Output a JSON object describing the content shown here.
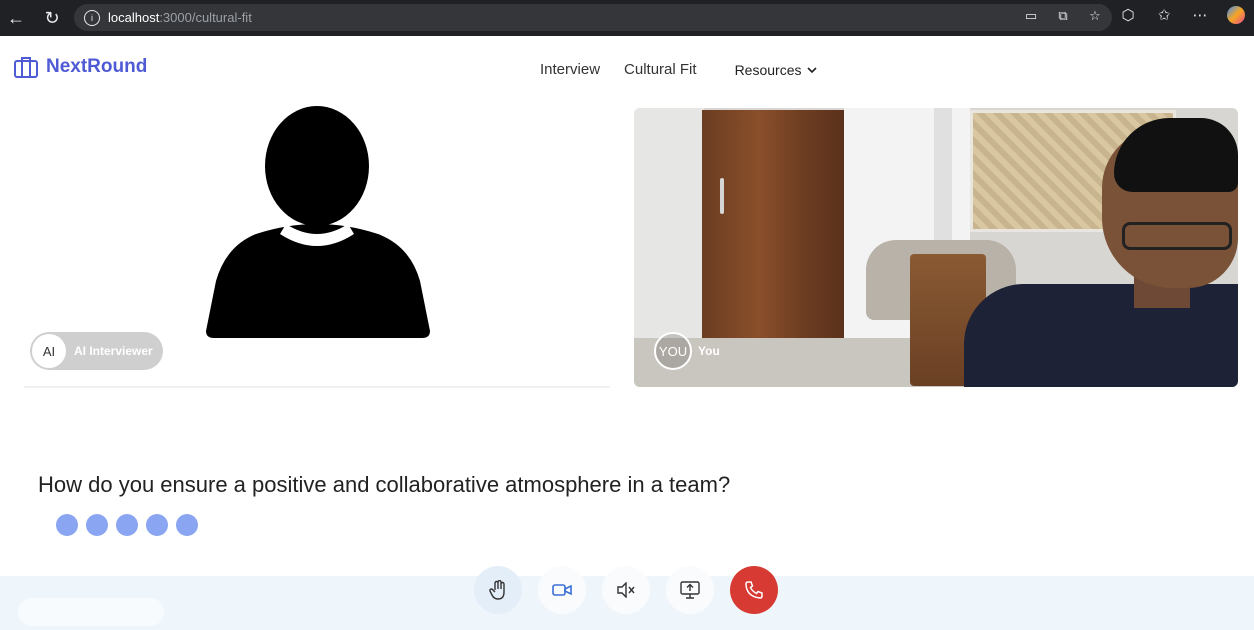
{
  "browser": {
    "url_host": "localhost",
    "url_path": ":3000/cultural-fit",
    "icons": [
      "back-icon",
      "reload-icon",
      "info-icon",
      "cast-icon",
      "screenshot-icon",
      "star-icon",
      "extensions-icon",
      "favorites-icon",
      "more-icon",
      "copilot-icon"
    ]
  },
  "header": {
    "brand": "NextRound",
    "nav": {
      "interview": "Interview",
      "cultural_fit": "Cultural Fit",
      "resources": "Resources"
    }
  },
  "ai_tile": {
    "avatar_initials": "AI",
    "label": "AI Interviewer"
  },
  "user_tile": {
    "avatar_initials": "YOU",
    "label": "You"
  },
  "question": {
    "text": "How do you ensure a positive and collaborative atmosphere in a team?"
  },
  "controls": {
    "icons": [
      "hand-icon",
      "video-camera-icon",
      "mute-icon",
      "screen-share-icon",
      "end-call-icon"
    ]
  },
  "colors": {
    "brand": "#4f5bd5",
    "dots": "#8aa6f2",
    "end_call": "#d63a33",
    "control_bar": "#eef6fc"
  }
}
